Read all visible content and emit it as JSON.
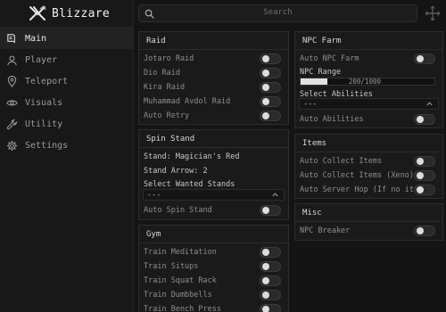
{
  "app": {
    "name": "Blizzare"
  },
  "search": {
    "placeholder": "Search"
  },
  "sidebar": {
    "items": [
      {
        "label": "Main",
        "icon": "book-icon",
        "active": true
      },
      {
        "label": "Player",
        "icon": "user-icon",
        "active": false
      },
      {
        "label": "Teleport",
        "icon": "map-pin-icon",
        "active": false
      },
      {
        "label": "Visuals",
        "icon": "eye-icon",
        "active": false
      },
      {
        "label": "Utility",
        "icon": "wrench-icon",
        "active": false
      },
      {
        "label": "Settings",
        "icon": "gear-icon",
        "active": false
      }
    ]
  },
  "raid": {
    "title": "Raid",
    "items": [
      "Jotaro Raid",
      "Dio Raid",
      "Kira Raid",
      "Muhammad Avdol Raid",
      "Auto Retry"
    ]
  },
  "spin_stand": {
    "title": "Spin Stand",
    "stand_label": "Stand: Magician's Red",
    "arrow_label": "Stand Arrow: 2",
    "wanted_label": "Select Wanted Stands",
    "wanted_value": "---",
    "auto_spin": "Auto Spin Stand"
  },
  "gym": {
    "title": "Gym",
    "items": [
      "Train Meditation",
      "Train Situps",
      "Train Squat Rack",
      "Train Dumbbells",
      "Train Bench Press"
    ]
  },
  "npc_farm": {
    "title": "NPC Farm",
    "auto_label": "Auto NPC Farm",
    "range_label": "NPC Range",
    "range_value": 200,
    "range_max": 1000,
    "range_text": "200/1000",
    "abilities_label": "Select Abilities",
    "abilities_value": "---",
    "auto_abilities": "Auto Abilities"
  },
  "items_panel": {
    "title": "Items",
    "items": [
      "Auto Collect Items",
      "Auto Collect Items (Xeno)",
      "Auto Server Hop (If no items)"
    ]
  },
  "misc": {
    "title": "Misc",
    "items": [
      "NPC Breaker"
    ]
  }
}
